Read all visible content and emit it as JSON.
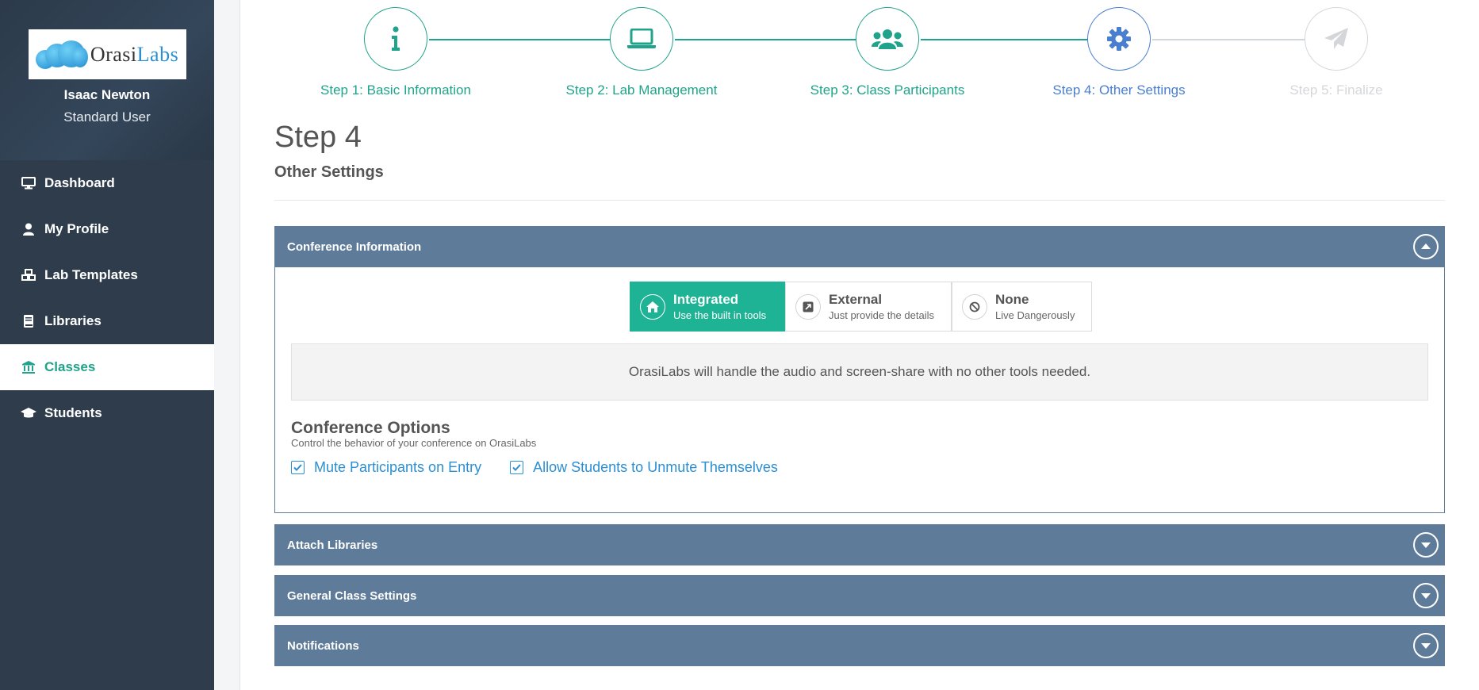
{
  "sidebar": {
    "logo": {
      "text_main": "Orasi",
      "text_accent": "Labs"
    },
    "user": {
      "name": "Isaac Newton",
      "role": "Standard User"
    },
    "items": [
      {
        "label": "Dashboard",
        "icon": "monitor-icon"
      },
      {
        "label": "My Profile",
        "icon": "user-icon"
      },
      {
        "label": "Lab Templates",
        "icon": "cubes-icon"
      },
      {
        "label": "Libraries",
        "icon": "book-icon"
      },
      {
        "label": "Classes",
        "icon": "institution-icon",
        "active": true
      },
      {
        "label": "Students",
        "icon": "graduation-cap-icon"
      }
    ]
  },
  "stepper": {
    "steps": [
      {
        "label": "Step 1: Basic Information",
        "icon": "info-icon",
        "state": "complete"
      },
      {
        "label": "Step 2: Lab Management",
        "icon": "laptop-icon",
        "state": "complete"
      },
      {
        "label": "Step 3: Class Participants",
        "icon": "users-icon",
        "state": "complete"
      },
      {
        "label": "Step 4: Other Settings",
        "icon": "gear-icon",
        "state": "current"
      },
      {
        "label": "Step 5: Finalize",
        "icon": "paper-plane-icon",
        "state": "pending"
      }
    ]
  },
  "page": {
    "title": "Step 4",
    "subtitle": "Other Settings"
  },
  "conference": {
    "header": "Conference Information",
    "options": [
      {
        "title": "Integrated",
        "desc": "Use the built in tools",
        "icon": "home-icon",
        "selected": true
      },
      {
        "title": "External",
        "desc": "Just provide the details",
        "icon": "external-link-icon",
        "selected": false
      },
      {
        "title": "None",
        "desc": "Live Dangerously",
        "icon": "ban-icon",
        "selected": false
      }
    ],
    "info_text": "OrasiLabs will handle the audio and screen-share with no other tools needed.",
    "options_title": "Conference Options",
    "options_desc": "Control the behavior of your conference on OrasiLabs",
    "checkboxes": [
      {
        "label": "Mute Participants on Entry",
        "checked": true
      },
      {
        "label": "Allow Students to Unmute Themselves",
        "checked": true
      }
    ]
  },
  "sections": [
    {
      "header": "Attach Libraries"
    },
    {
      "header": "General Class Settings"
    },
    {
      "header": "Notifications"
    }
  ],
  "colors": {
    "accent_green": "#1fa38a",
    "accent_blue": "#4a7fd0",
    "accordion_header": "#5e7b9a",
    "sidebar_bg": "#2f3c4c",
    "pending_gray": "#d4d7da"
  }
}
